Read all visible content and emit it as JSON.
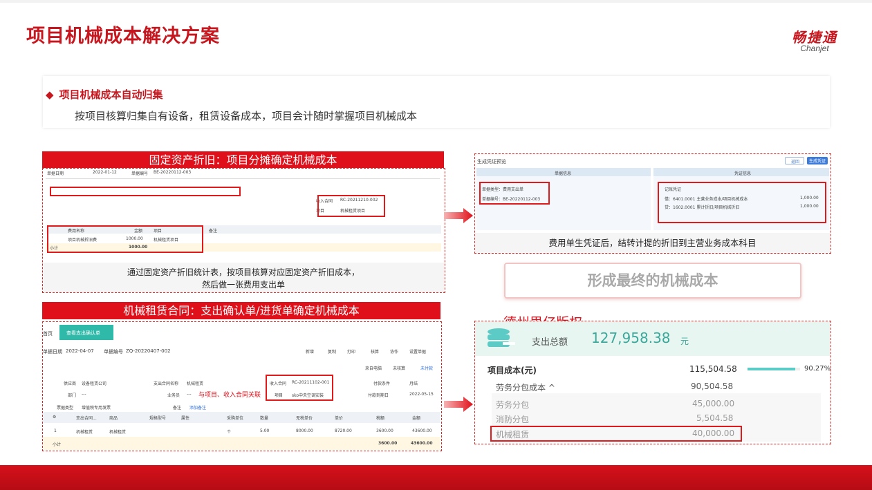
{
  "slide": {
    "title": "项目机械成本解决方案",
    "logo_cn": "畅捷通",
    "logo_en": "Chanjet"
  },
  "intro": {
    "heading": "项目机械成本自动归集",
    "description": "按项目核算归集自有设备，租赁设备成本，项目会计随时掌握项目机械成本"
  },
  "panel1": {
    "bar_title": "固定资产折旧：项目分摊确定机械成本",
    "caption_line1": "通过固定资产折旧统计表，按项目核算对应固定资产折旧成本，",
    "caption_line2": "然后做一张费用支出单",
    "mini": {
      "date_label": "单据日期",
      "date": "2022-01-12",
      "no_label": "单据编号",
      "no": "BE-20220112-003",
      "contract_label": "收入合同",
      "contract": "RC-20211210-002",
      "project_label": "项目",
      "project": "机械租赁项目",
      "col_name": "费用名称",
      "col_amount": "金额",
      "col_project": "项目",
      "col_note": "备注",
      "row_name": "项目机械折旧费",
      "row_amount": "1000.00",
      "row_project": "机械租赁项目",
      "subtotal_label": "小计",
      "subtotal": "1000.00"
    }
  },
  "panel2": {
    "caption": "费用单生凭证后，结转计提的折旧到主营业务成本科目",
    "mini": {
      "header": "生成凭证预览",
      "left_col": "单据信息",
      "right_col": "凭证信息",
      "left_line1": "单据类型：费用支出单",
      "left_line2": "单据编号：BE-20220112-003",
      "right_title": "记账凭证",
      "right_line1": "借：6401.0001 主营业务成本/项目机械成本",
      "right_amount1": "1,000.00",
      "right_line2": "贷：1602.0001 累计折旧/项目机械折旧",
      "right_amount2": "1,000.00",
      "btn1": "返回",
      "btn2": "生成凭证"
    }
  },
  "final_label": "形成最终的机械成本",
  "copyright": "德州思亿版权",
  "panel3": {
    "bar_title": "机械租赁合同：支出确认单/进货单确定机械成本",
    "annotation": "与项目、收入合同关联",
    "mini": {
      "tab_home": "首页",
      "tab_doc": "查看支出确认单",
      "date_label": "单据日期",
      "date": "2022-04-07",
      "no_label": "单据编号",
      "no": "ZQ-20220407-002",
      "actions": [
        "新增",
        "复制",
        "打印",
        "核算",
        "协作",
        "设置单据"
      ],
      "status1": "来自电脑",
      "status2": "未核算",
      "status3": "未付款",
      "supplier_label": "供应商",
      "supplier": "设备租赁公司",
      "contract_name_label": "支出合同名称",
      "contract_name": "机械租赁",
      "income_contract_label": "收入合同",
      "income_contract": "RC-20211102-001",
      "project_label": "项目",
      "project": "sko中央空调安装",
      "dept_label": "部门",
      "dept": "---",
      "salesman_label": "业务员",
      "salesman": "---",
      "pay_terms_label": "付款条件",
      "pay_terms": "月结",
      "pay_date_label": "付款到期日",
      "pay_date": "2022-05-15",
      "invoice_label": "票据类型",
      "invoice": "增值税专用发票",
      "note_label": "备注",
      "note_btn": "添加备注",
      "columns": [
        "支出合同...",
        "商品",
        "规格型号",
        "属性",
        "采购单位",
        "数量",
        "无税单价",
        "单价",
        "税额",
        "金额"
      ],
      "row": [
        "机械租赁",
        "机械租赁",
        "",
        "",
        "个",
        "5.00",
        "8000.00",
        "8720.00",
        "3600.00",
        "43600.00"
      ],
      "subtotal_label": "小计",
      "subtotal_tax": "3600.00",
      "subtotal_amount": "43600.00"
    }
  },
  "cost_panel": {
    "total_label": "支出总额",
    "total_value": "127,958.38",
    "total_unit": "元",
    "project_cost_label": "项目成本(元)",
    "project_cost_value": "115,504.58",
    "project_cost_pct": "90.27%",
    "project_cost_fraction": 0.9027,
    "labor_label": "劳务分包成本 ^",
    "labor_value": "90,504.58",
    "items": [
      {
        "label": "劳务分包",
        "value": "45,000.00"
      },
      {
        "label": "消防分包",
        "value": "5,504.58"
      },
      {
        "label": "机械租赁",
        "value": "40,000.00"
      }
    ],
    "accent": "#5ccbc6"
  },
  "colors": {
    "brand_red": "#c8161e",
    "bar_red": "#e0101a"
  }
}
